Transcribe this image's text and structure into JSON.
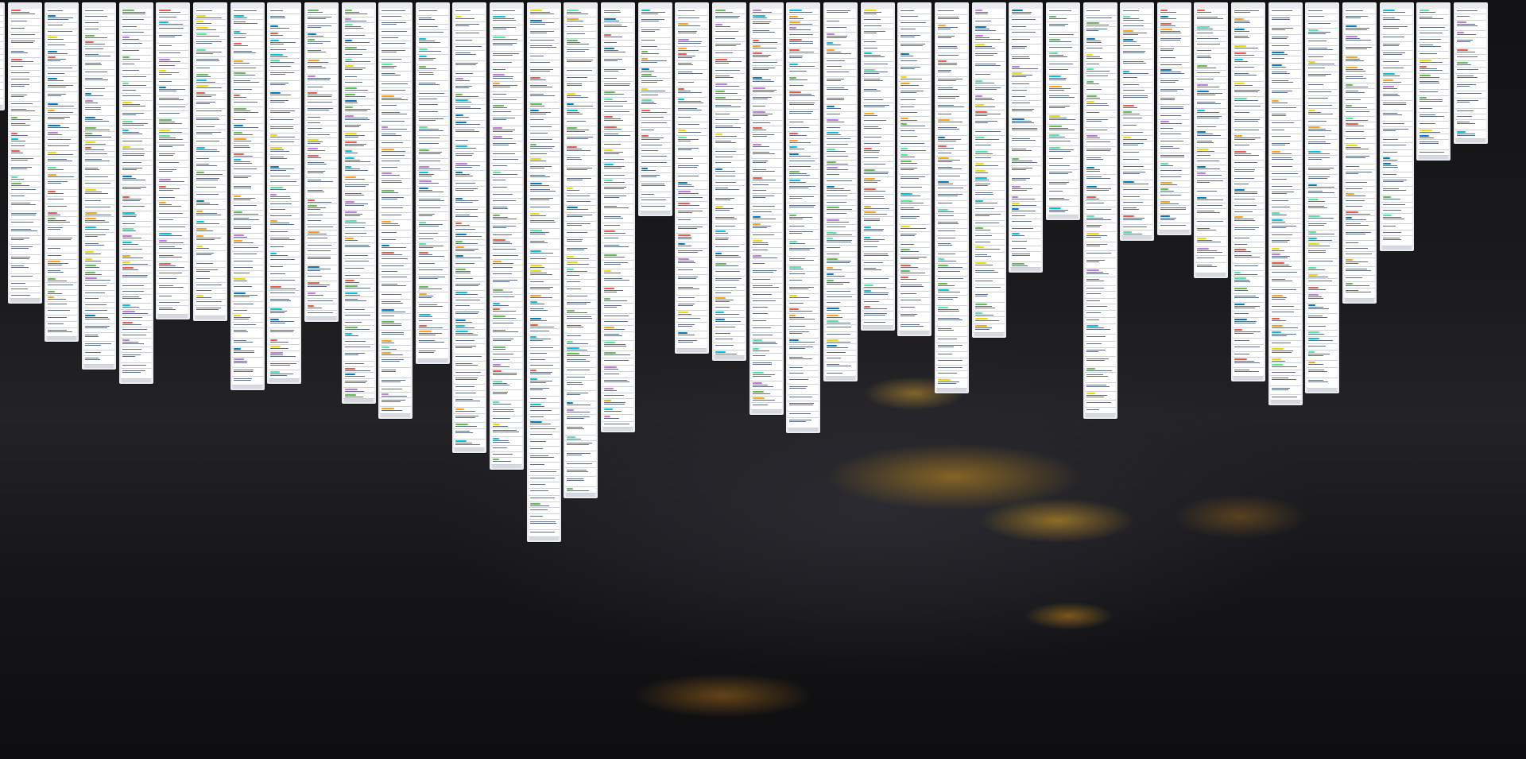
{
  "board": {
    "list_count": 41,
    "card_counts": [
      14,
      38,
      45,
      49,
      51,
      40,
      41,
      50,
      48,
      41,
      54,
      55,
      44,
      58,
      61,
      71,
      60,
      54,
      28,
      42,
      48,
      53,
      55,
      54,
      41,
      44,
      49,
      42,
      33,
      25,
      52,
      32,
      30,
      35,
      47,
      52,
      49,
      38,
      31,
      20,
      17
    ],
    "label_colors": [
      "#61bd4f",
      "#f2d600",
      "#ff9f1a",
      "#eb5a46",
      "#c377e0",
      "#0079bf",
      "#00c2e0",
      "#51e898"
    ]
  }
}
